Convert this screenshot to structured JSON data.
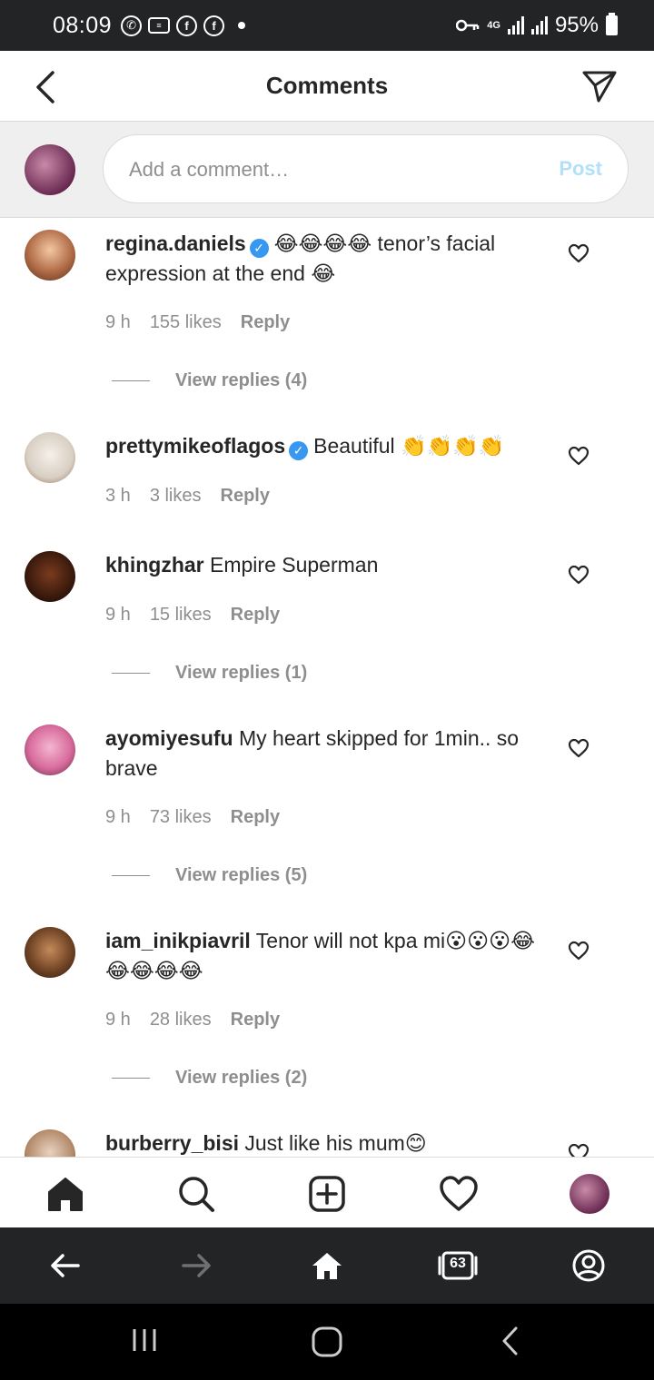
{
  "status_bar": {
    "time": "08:09",
    "network": "4G",
    "battery": "95%"
  },
  "header": {
    "title": "Comments",
    "back_icon": "chevron-left-icon",
    "send_icon": "paper-plane-icon"
  },
  "composer": {
    "placeholder": "Add a comment…",
    "post_label": "Post"
  },
  "comments": [
    {
      "username": "regina.daniels",
      "verified": true,
      "text": "😂😂😂😂 tenor’s facial expression at the end 😂",
      "time": "9 h",
      "likes": "155 likes",
      "reply": "Reply",
      "view_replies": "View replies (4)"
    },
    {
      "username": "prettymikeoflagos",
      "verified": true,
      "text": "Beautiful 👏👏👏👏",
      "time": "3 h",
      "likes": "3 likes",
      "reply": "Reply"
    },
    {
      "username": "khingzhar",
      "verified": false,
      "text": "Empire Superman",
      "time": "9 h",
      "likes": "15 likes",
      "reply": "Reply",
      "view_replies": "View replies (1)"
    },
    {
      "username": "ayomiyesufu",
      "verified": false,
      "text": "My heart skipped for 1min.. so brave",
      "time": "9 h",
      "likes": "73 likes",
      "reply": "Reply",
      "view_replies": "View replies (5)"
    },
    {
      "username": "iam_inikpiavril",
      "verified": false,
      "text": "Tenor will not kpa mi😮😮😮😂😂😂😂😂",
      "time": "9 h",
      "likes": "28 likes",
      "reply": "Reply",
      "view_replies": "View replies (2)"
    },
    {
      "username": "burberry_bisi",
      "verified": false,
      "text": "Just like his mum😊"
    }
  ],
  "tabs": [
    {
      "name": "home",
      "icon": "home-icon"
    },
    {
      "name": "search",
      "icon": "search-icon"
    },
    {
      "name": "create",
      "icon": "add-post-icon"
    },
    {
      "name": "activity",
      "icon": "heart-icon"
    },
    {
      "name": "profile",
      "icon": "avatar"
    }
  ],
  "browser_bar": {
    "tab_count": "63"
  },
  "colors": {
    "link_blue": "#3897f0",
    "post_disabled": "#b2dffc",
    "secondary_text": "#8e8e8e"
  }
}
